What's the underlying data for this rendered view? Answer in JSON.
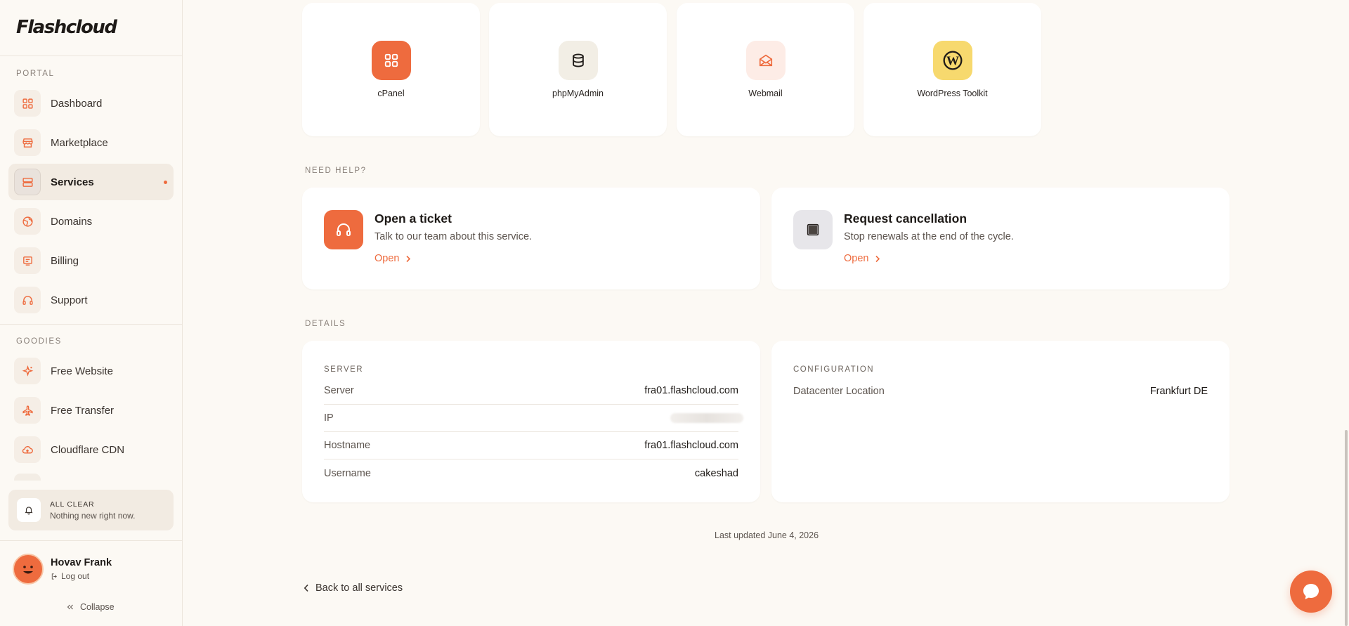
{
  "brand": "Flashcloud",
  "sidebar": {
    "portal_label": "PORTAL",
    "portal_items": [
      {
        "label": "Dashboard",
        "icon": "grid-icon"
      },
      {
        "label": "Marketplace",
        "icon": "store-icon"
      },
      {
        "label": "Services",
        "icon": "server-icon",
        "active": true,
        "dot": true
      },
      {
        "label": "Domains",
        "icon": "globe-icon"
      },
      {
        "label": "Billing",
        "icon": "receipt-icon"
      },
      {
        "label": "Support",
        "icon": "headset-icon"
      }
    ],
    "goodies_label": "GOODIES",
    "goodies_items": [
      {
        "label": "Free Website",
        "icon": "sparkle-icon"
      },
      {
        "label": "Free Transfer",
        "icon": "plane-icon"
      },
      {
        "label": "Cloudflare CDN",
        "icon": "cloud-icon"
      }
    ],
    "notice": {
      "title": "ALL CLEAR",
      "subtitle": "Nothing new right now."
    },
    "user": {
      "name": "Hovav Frank",
      "logout": "Log out"
    },
    "collapse": "Collapse"
  },
  "apps": [
    {
      "label": "cPanel",
      "icon": "cpanel-icon"
    },
    {
      "label": "phpMyAdmin",
      "icon": "database-icon"
    },
    {
      "label": "Webmail",
      "icon": "mail-icon"
    },
    {
      "label": "WordPress Toolkit",
      "icon": "wordpress-icon"
    }
  ],
  "help": {
    "label": "NEED HELP?",
    "ticket": {
      "title": "Open a ticket",
      "subtitle": "Talk to our team about this service.",
      "link": "Open"
    },
    "cancel": {
      "title": "Request cancellation",
      "subtitle": "Stop renewals at the end of the cycle.",
      "link": "Open"
    }
  },
  "details": {
    "label": "DETAILS",
    "server": {
      "heading": "SERVER",
      "rows": [
        {
          "key": "Server",
          "value": "fra01.flashcloud.com"
        },
        {
          "key": "IP",
          "value": ""
        },
        {
          "key": "Hostname",
          "value": "fra01.flashcloud.com"
        },
        {
          "key": "Username",
          "value": "cakeshad"
        }
      ]
    },
    "config": {
      "heading": "CONFIGURATION",
      "rows": [
        {
          "key": "Datacenter Location",
          "value": "Frankfurt DE"
        }
      ]
    }
  },
  "last_updated": "Last updated June 4, 2026",
  "back_link": "Back to all services",
  "colors": {
    "accent": "#ee6b3e",
    "background": "#fcf9f4",
    "card": "#ffffff"
  }
}
